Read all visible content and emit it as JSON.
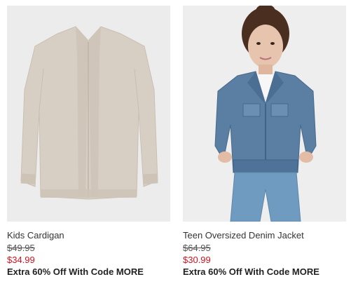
{
  "colors": {
    "sale_price": "#d1121f",
    "image_background": "#ededed"
  },
  "products": [
    {
      "name": "Kids Cardigan",
      "original_price": "$49.95",
      "sale_price": "$34.99",
      "promo": "Extra 60% Off With Code MORE",
      "image_icon": "cardigan-image"
    },
    {
      "name": "Teen Oversized Denim Jacket",
      "original_price": "$64.95",
      "sale_price": "$30.99",
      "promo": "Extra 60% Off With Code MORE",
      "image_icon": "denim-jacket-image"
    }
  ]
}
